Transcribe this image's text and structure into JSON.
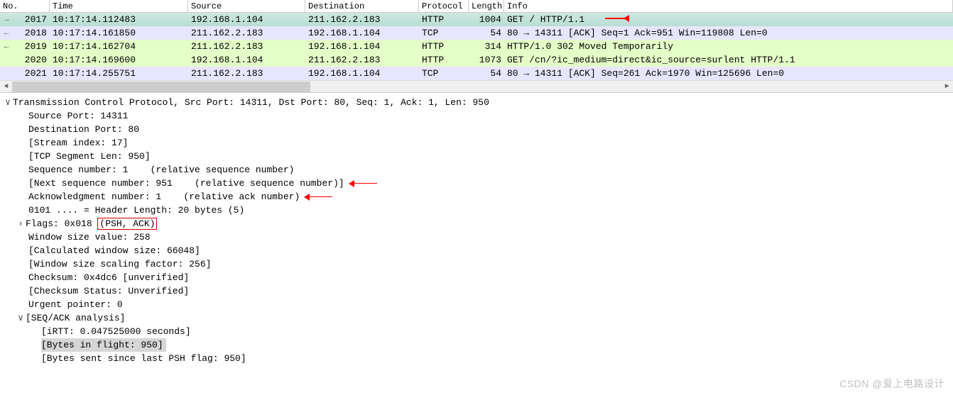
{
  "columns": {
    "no": "No.",
    "time": "Time",
    "src": "Source",
    "dst": "Destination",
    "proto": "Protocol",
    "len": "Length",
    "info": "Info"
  },
  "rows": [
    {
      "no": "2017",
      "time": "10:17:14.112483",
      "src": "192.168.1.104",
      "dst": "211.162.2.183",
      "proto": "HTTP",
      "len": "1004",
      "info": "GET / HTTP/1.1",
      "cls": "selected-row",
      "glyph": "→",
      "arrow": true
    },
    {
      "no": "2018",
      "time": "10:17:14.161850",
      "src": "211.162.2.183",
      "dst": "192.168.1.104",
      "proto": "TCP",
      "len": "54",
      "info": "80 → 14311 [ACK] Seq=1 Ack=951 Win=119808 Len=0",
      "cls": "tcp-row",
      "glyph": "←"
    },
    {
      "no": "2019",
      "time": "10:17:14.162704",
      "src": "211.162.2.183",
      "dst": "192.168.1.104",
      "proto": "HTTP",
      "len": "314",
      "info": "HTTP/1.0 302 Moved Temporarily",
      "cls": "http-row",
      "glyph": "←"
    },
    {
      "no": "2020",
      "time": "10:17:14.169600",
      "src": "192.168.1.104",
      "dst": "211.162.2.183",
      "proto": "HTTP",
      "len": "1073",
      "info": "GET /cn/?ic_medium=direct&ic_source=surlent HTTP/1.1",
      "cls": "http-row",
      "glyph": ""
    },
    {
      "no": "2021",
      "time": "10:17:14.255751",
      "src": "211.162.2.183",
      "dst": "192.168.1.104",
      "proto": "TCP",
      "len": "54",
      "info": "80 → 14311 [ACK] Seq=261 Ack=1970 Win=125696 Len=0",
      "cls": "tcp-row",
      "glyph": ""
    }
  ],
  "detail": {
    "header": "Transmission Control Protocol, Src Port: 14311, Dst Port: 80, Seq: 1, Ack: 1, Len: 950",
    "src_port": "Source Port: 14311",
    "dst_port": "Destination Port: 80",
    "stream": "[Stream index: 17]",
    "seg_len": "[TCP Segment Len: 950]",
    "seq": "Sequence number: 1    (relative sequence number)",
    "next_seq": "[Next sequence number: 951    (relative sequence number)]",
    "ack": "Acknowledgment number: 1    (relative ack number)",
    "hdr_len": "0101 .... = Header Length: 20 bytes (5)",
    "flags_pre": "Flags: 0x018 ",
    "flags_box": "(PSH, ACK)",
    "win": "Window size value: 258",
    "calc_win": "[Calculated window size: 66048]",
    "scale": "[Window size scaling factor: 256]",
    "cksum": "Checksum: 0x4dc6 [unverified]",
    "cksum_s": "[Checksum Status: Unverified]",
    "urg": "Urgent pointer: 0",
    "seqack": "[SEQ/ACK analysis]",
    "irtt": "[iRTT: 0.047525000 seconds]",
    "bif": "[Bytes in flight: 950]",
    "since_psh": "[Bytes sent since last PSH flag: 950]"
  },
  "watermark": "CSDN @爱上电路设计"
}
